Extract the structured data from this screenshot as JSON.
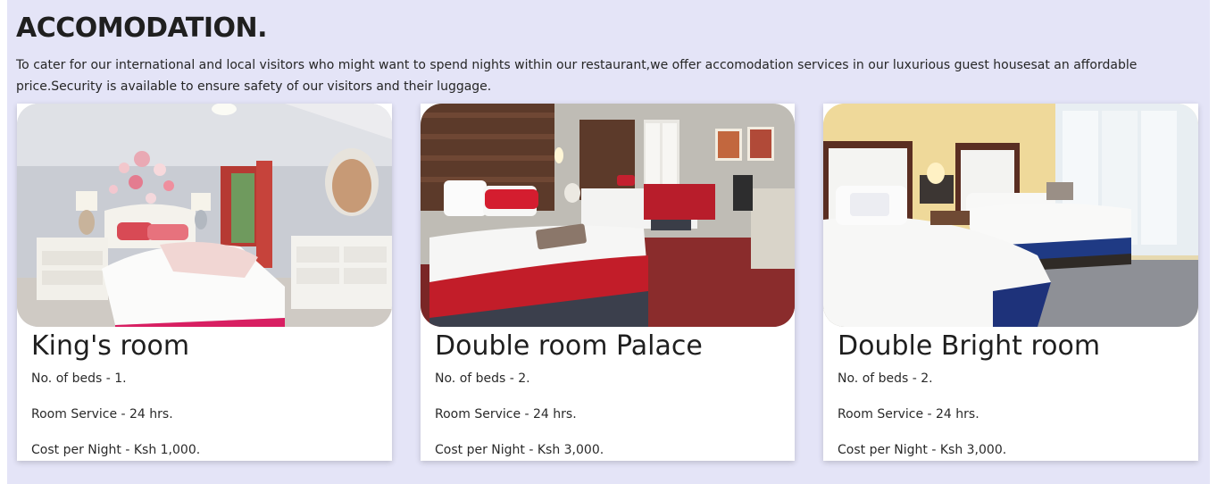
{
  "section": {
    "title": "ACCOMODATION.",
    "intro": "To cater for our international and local visitors who might want to spend nights within our restaurant,we offer accomodation services in our luxurious guest housesat an affordable price.Security is available to ensure safety of our visitors and their luggage."
  },
  "rooms": [
    {
      "name": "King's room",
      "beds": "No. of beds - 1.",
      "service": "Room Service - 24 hrs.",
      "cost": "Cost per Night - Ksh 1,000.",
      "image": "kings-room-photo"
    },
    {
      "name": "Double room Palace",
      "beds": "No. of beds - 2.",
      "service": "Room Service - 24 hrs.",
      "cost": "Cost per Night - Ksh 3,000.",
      "image": "double-room-palace-photo"
    },
    {
      "name": "Double Bright room",
      "beds": "No. of beds - 2.",
      "service": "Room Service - 24 hrs.",
      "cost": "Cost per Night - Ksh 3,000.",
      "image": "double-bright-room-photo"
    }
  ],
  "colors": {
    "section_background": "#e4e4f7",
    "card_background": "#ffffff",
    "text": "#222222"
  }
}
